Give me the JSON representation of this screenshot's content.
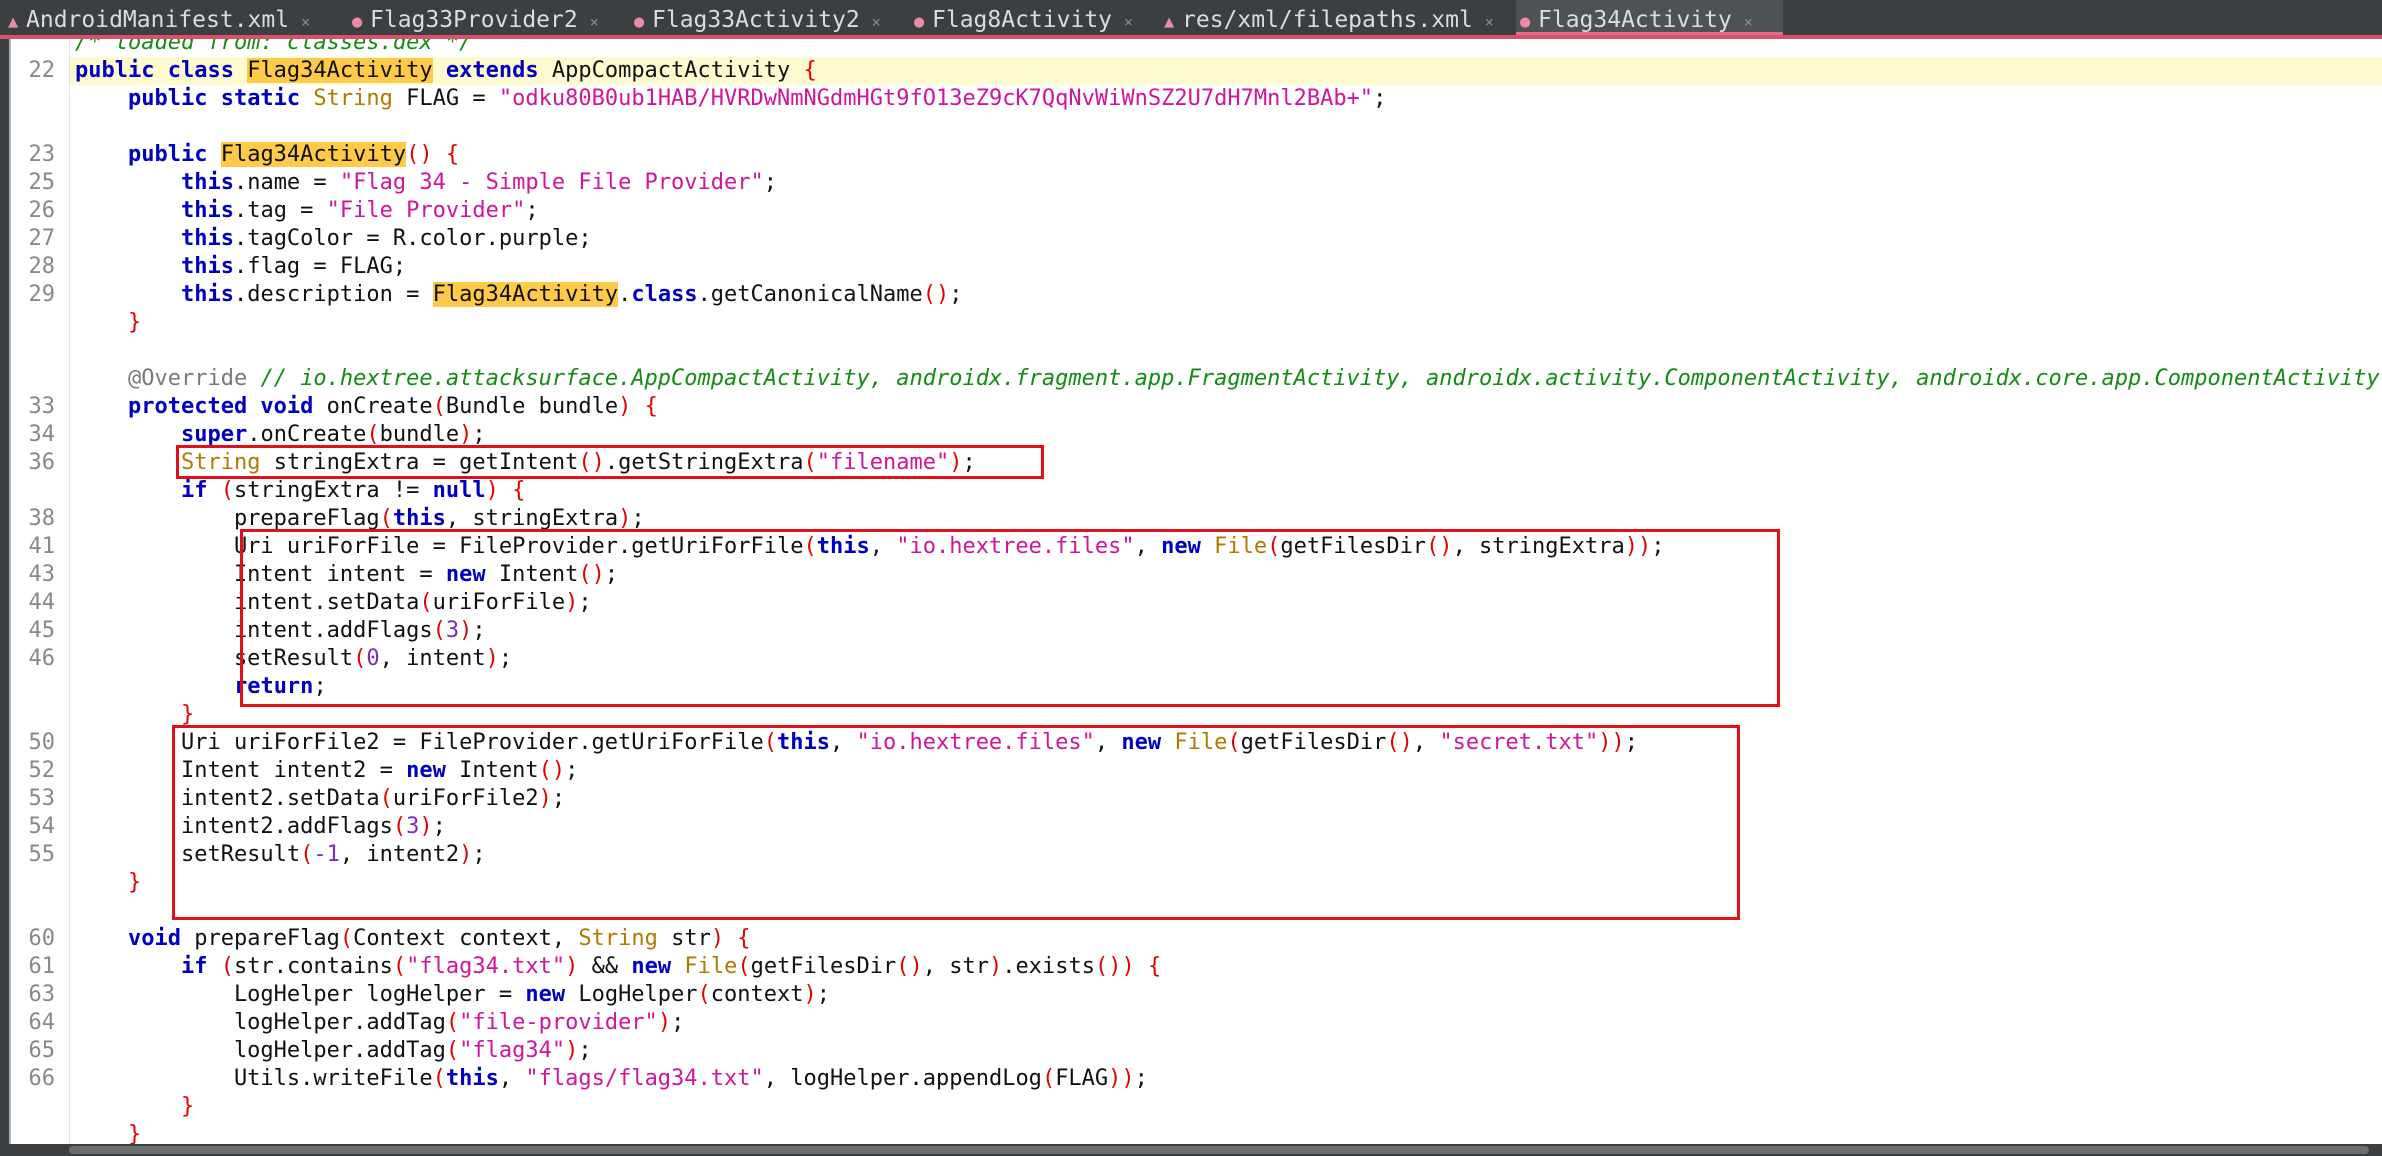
{
  "tabs": [
    {
      "label": "AndroidManifest.xml",
      "icon": "manifest-icon",
      "active": false
    },
    {
      "label": "Flag33Provider2",
      "icon": "class-icon",
      "active": false
    },
    {
      "label": "Flag33Activity2",
      "icon": "class-icon",
      "active": false
    },
    {
      "label": "Flag8Activity",
      "icon": "class-icon",
      "active": false
    },
    {
      "label": "res/xml/filepaths.xml",
      "icon": "xml-icon",
      "active": false
    },
    {
      "label": "Flag34Activity",
      "icon": "class-icon",
      "active": true
    }
  ],
  "close_glyph": "×",
  "gutter": {
    "l0": "",
    "l1": "22",
    "l2": "",
    "l3": "",
    "l4": "23",
    "l5": "25",
    "l6": "26",
    "l7": "27",
    "l8": "28",
    "l9": "29",
    "l10": "",
    "l11": "",
    "l12": "",
    "l13": "33",
    "l14": "34",
    "l15": "36",
    "l16": "",
    "l17": "38",
    "l18": "41",
    "l19": "43",
    "l20": "44",
    "l21": "45",
    "l22": "46",
    "l23": "",
    "l24": "",
    "l25": "50",
    "l26": "52",
    "l27": "53",
    "l28": "54",
    "l29": "55",
    "l30": "",
    "l31": "",
    "l32": "60",
    "l33": "61",
    "l34": "63",
    "l35": "64",
    "l36": "65",
    "l37": "66",
    "l38": "",
    "l39": ""
  },
  "code": {
    "loaded_comment": "/* loaded from: classes.dex */",
    "class_name": "Flag34Activity",
    "super_class": "AppCompactActivity",
    "flag_value": "\"odku80B0ub1HAB/HVRDwNmNGdmHGt9fO13eZ9cK7QqNvWiWnSZ2U7dH7Mnl2BAb+\"",
    "name_value": "\"Flag 34 - Simple File Provider\"",
    "tag_value": "\"File Provider\"",
    "override": "@Override",
    "override_comment": "// io.hextree.attacksurface.AppCompactActivity, androidx.fragment.app.FragmentActivity, androidx.activity.ComponentActivity, androidx.core.app.ComponentActivity",
    "filename_str": "\"filename\"",
    "authority_str": "\"io.hextree.files\"",
    "secret_str": "\"secret.txt\"",
    "flag34_txt": "\"flag34.txt\"",
    "file_provider_tag": "\"file-provider\"",
    "flag34_tag": "\"flag34\"",
    "flags_path": "\"flags/flag34.txt\""
  }
}
